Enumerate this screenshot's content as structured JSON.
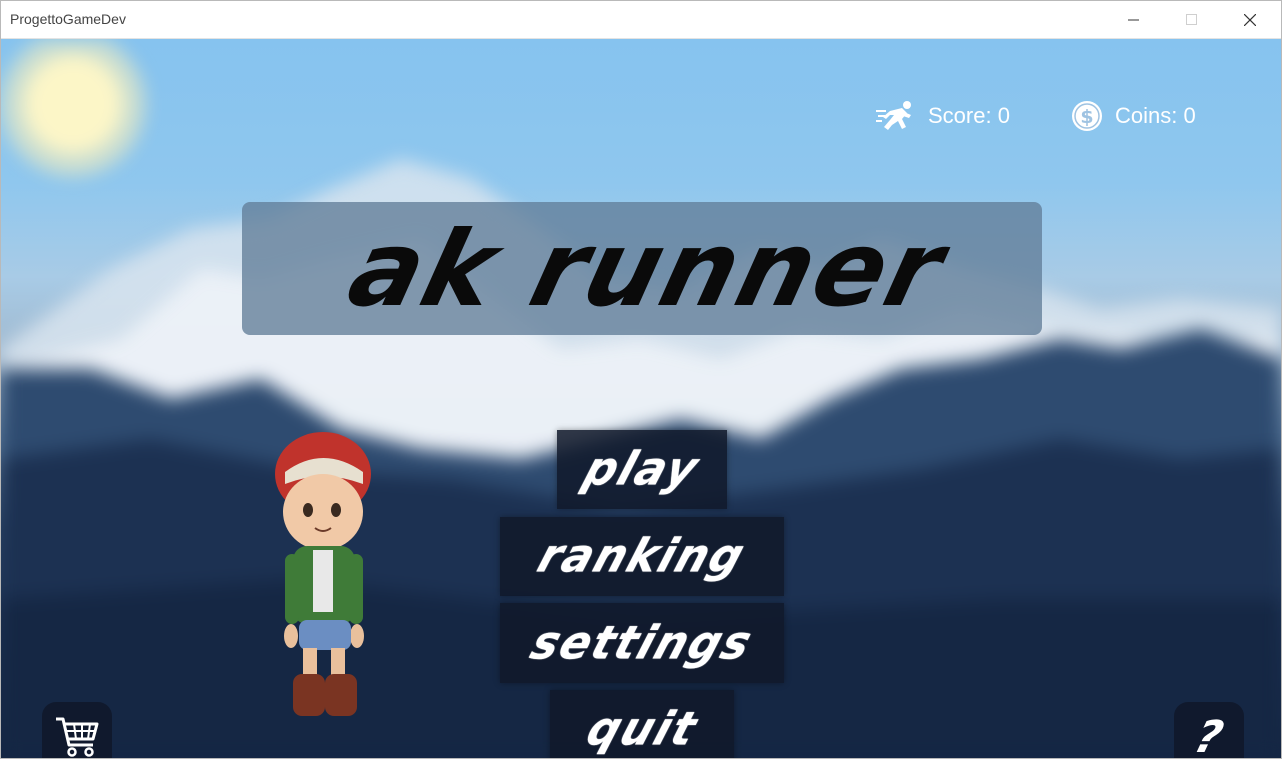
{
  "window": {
    "title": "ProgettoGameDev"
  },
  "hud": {
    "score_label": "Score: 0",
    "coins_label": "Coins: 0",
    "score_icon": "runner-icon",
    "coins_icon": "coin-icon"
  },
  "logo": {
    "text": "ak runner"
  },
  "menu": {
    "play": "play",
    "ranking": "ranking",
    "settings": "settings",
    "quit": "quit"
  },
  "corner": {
    "shop_icon": "shopping-cart-icon",
    "help_label": "?"
  },
  "colors": {
    "sky": "#8fc7ee",
    "panel": "#6a86a3",
    "button": "#10182a",
    "text": "#ffffff"
  }
}
